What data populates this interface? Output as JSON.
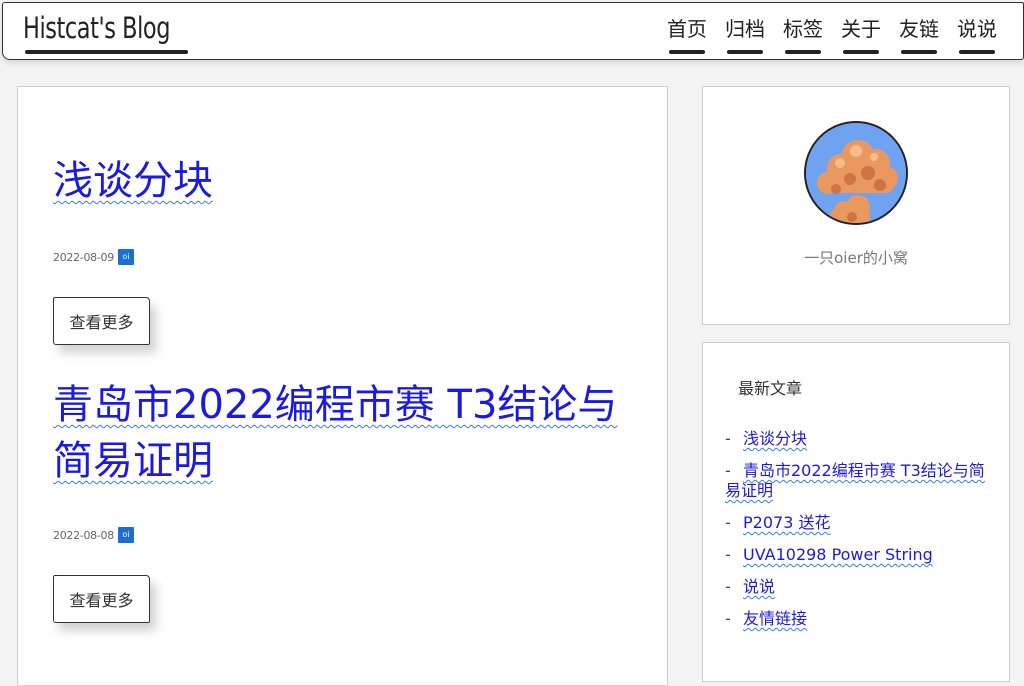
{
  "site": {
    "logo": "Histcat's Blog"
  },
  "nav": [
    "首页",
    "归档",
    "标签",
    "关于",
    "友链",
    "说说"
  ],
  "posts": [
    {
      "title": "浅谈分块",
      "date": "2022-08-09",
      "tag": "oi",
      "more": "查看更多"
    },
    {
      "title_line1": "青岛市2022编程市赛 T3结论与",
      "title_line2": "简易证明",
      "date": "2022-08-08",
      "tag": "oi",
      "more": "查看更多"
    }
  ],
  "profile": {
    "description": "一只oier的小窝"
  },
  "recent": {
    "title": "最新文章",
    "items": [
      "浅谈分块",
      "青岛市2022编程市赛 T3结论与简易证明",
      "P2073 送花",
      "UVA10298 Power String",
      "说说",
      "友情链接"
    ]
  },
  "colors": {
    "link": "#1a1ae0",
    "tag": "#1a6fd6",
    "sky": "#6fa3f2"
  }
}
